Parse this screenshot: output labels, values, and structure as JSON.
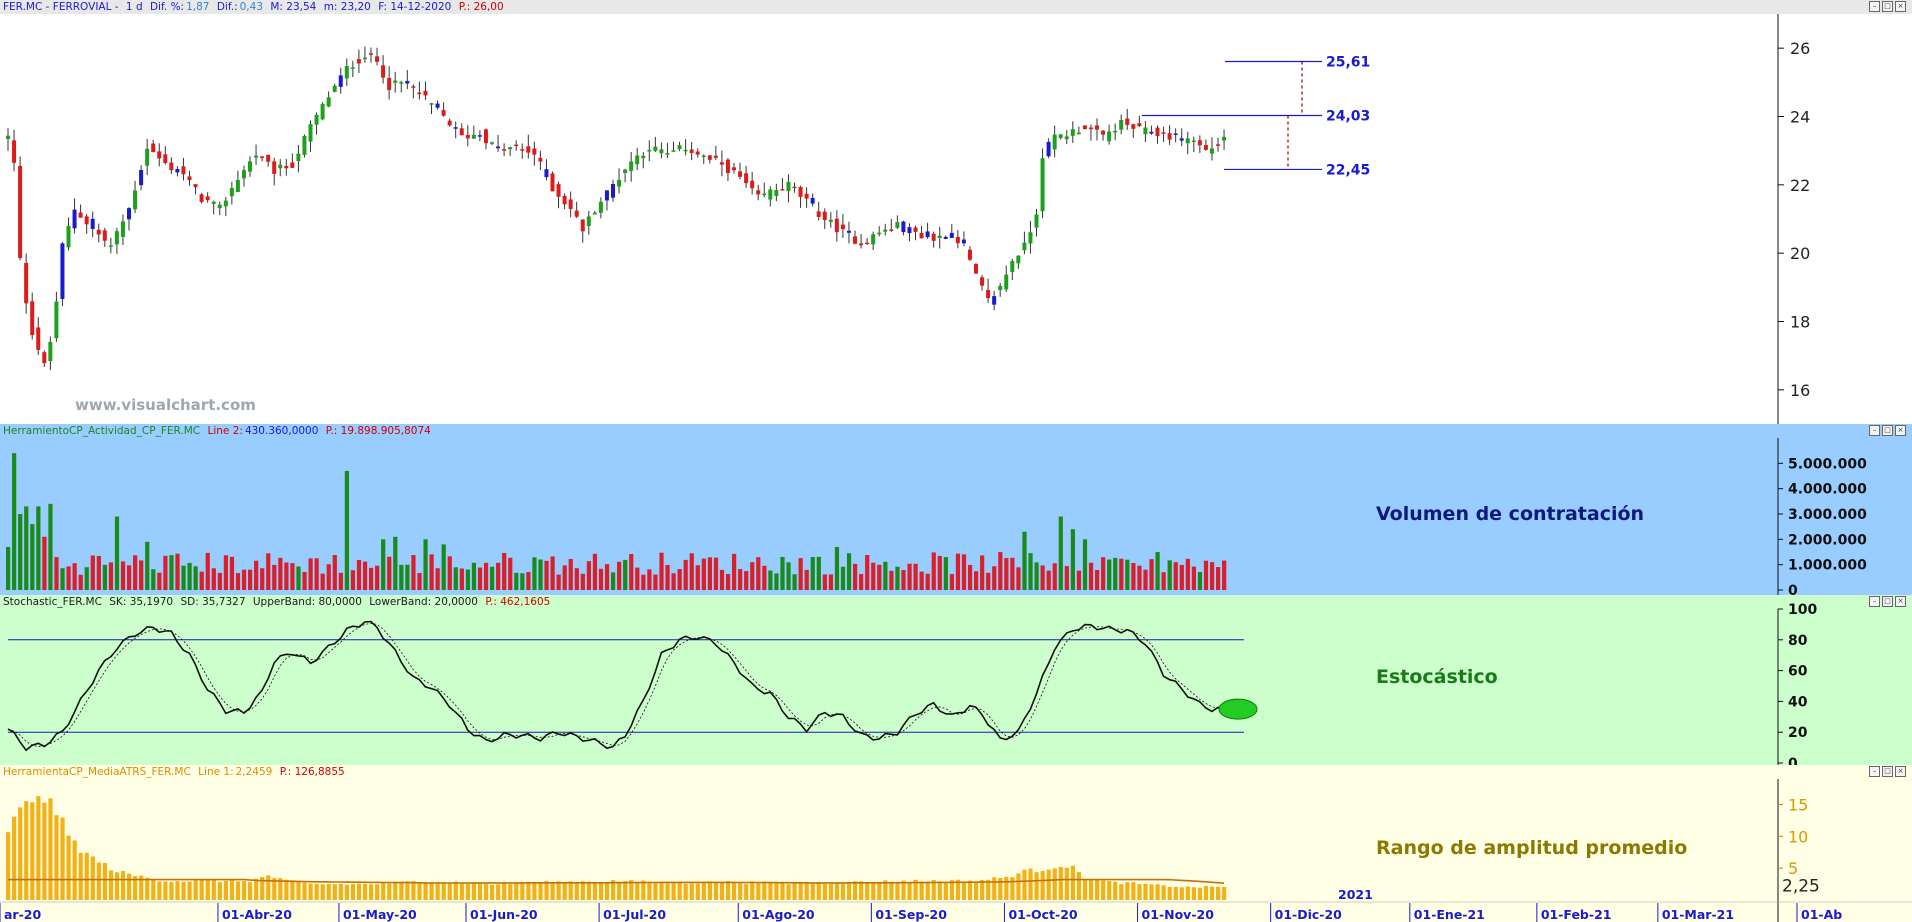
{
  "chart_data": [
    {
      "type": "candlestick",
      "header": {
        "symbol": "FER.MC - FERROVIAL -",
        "period": "1 d",
        "dif_pct_label": "Dif. %:",
        "dif_pct_value": "1,87",
        "dif_label": "Dif.:",
        "dif_value": "0,43",
        "max_label": "M: 23,54",
        "min_label": "m: 23,20",
        "date_label": "F: 14-12-2020",
        "price_label": "P.: 26,00"
      },
      "watermark": "www.visualchart.com",
      "ylim": [
        15.0,
        27.0
      ],
      "yticks": [
        "26",
        "24",
        "22",
        "20",
        "18",
        "16"
      ],
      "ytick_values": [
        26,
        24,
        22,
        20,
        18,
        16
      ],
      "levels": [
        {
          "label": "25,61",
          "value": 25.61
        },
        {
          "label": "24,03",
          "value": 24.03
        },
        {
          "label": "22,45",
          "value": 22.45
        }
      ],
      "price_waypoints": [
        [
          0,
          23.4
        ],
        [
          1,
          22.6
        ],
        [
          2,
          19.8
        ],
        [
          3,
          18.6
        ],
        [
          4,
          17.7
        ],
        [
          5,
          17.2
        ],
        [
          6,
          16.7
        ],
        [
          7,
          17.4
        ],
        [
          8,
          18.6
        ],
        [
          9,
          20.2
        ],
        [
          11,
          21.3
        ],
        [
          14,
          20.7
        ],
        [
          17,
          20.2
        ],
        [
          20,
          21.3
        ],
        [
          23,
          23.1
        ],
        [
          26,
          22.6
        ],
        [
          29,
          22.3
        ],
        [
          32,
          21.6
        ],
        [
          35,
          21.3
        ],
        [
          38,
          22.2
        ],
        [
          41,
          22.9
        ],
        [
          44,
          22.4
        ],
        [
          47,
          22.6
        ],
        [
          50,
          23.7
        ],
        [
          53,
          24.6
        ],
        [
          56,
          25.4
        ],
        [
          59,
          25.8
        ],
        [
          61,
          25.6
        ],
        [
          63,
          24.9
        ],
        [
          66,
          25.0
        ],
        [
          69,
          24.5
        ],
        [
          72,
          24.0
        ],
        [
          75,
          23.4
        ],
        [
          78,
          23.5
        ],
        [
          81,
          23.0
        ],
        [
          84,
          23.1
        ],
        [
          87,
          22.9
        ],
        [
          90,
          21.9
        ],
        [
          93,
          21.3
        ],
        [
          95,
          20.7
        ],
        [
          97,
          21.3
        ],
        [
          100,
          22.0
        ],
        [
          103,
          22.7
        ],
        [
          106,
          23.1
        ],
        [
          109,
          22.9
        ],
        [
          112,
          23.1
        ],
        [
          115,
          22.8
        ],
        [
          118,
          22.6
        ],
        [
          121,
          22.2
        ],
        [
          124,
          21.6
        ],
        [
          126,
          21.8
        ],
        [
          129,
          22.0
        ],
        [
          132,
          21.5
        ],
        [
          135,
          21.0
        ],
        [
          138,
          20.6
        ],
        [
          141,
          20.3
        ],
        [
          144,
          20.6
        ],
        [
          147,
          20.8
        ],
        [
          150,
          20.6
        ],
        [
          153,
          20.4
        ],
        [
          156,
          20.6
        ],
        [
          158,
          20.2
        ],
        [
          160,
          19.3
        ],
        [
          162,
          18.6
        ],
        [
          164,
          19.0
        ],
        [
          166,
          19.8
        ],
        [
          168,
          20.2
        ],
        [
          170,
          21.2
        ],
        [
          171,
          22.9
        ],
        [
          173,
          23.4
        ],
        [
          175,
          23.5
        ],
        [
          178,
          23.7
        ],
        [
          181,
          23.4
        ],
        [
          184,
          23.8
        ],
        [
          187,
          23.6
        ],
        [
          190,
          23.5
        ],
        [
          193,
          23.4
        ],
        [
          196,
          23.3
        ],
        [
          198,
          23.0
        ],
        [
          200,
          23.2
        ],
        [
          201,
          23.4
        ]
      ],
      "x_labels": [
        {
          "label": "ar-20",
          "idx": 0
        },
        {
          "label": "01-Abr-20",
          "idx": 19
        },
        {
          "label": "01-May-20",
          "idx": 39
        },
        {
          "label": "01-Jun-20",
          "idx": 60
        },
        {
          "label": "01-Jul-20",
          "idx": 82
        },
        {
          "label": "01-Ago-20",
          "idx": 105
        },
        {
          "label": "01-Sep-20",
          "idx": 127
        },
        {
          "label": "01-Oct-20",
          "idx": 149
        },
        {
          "label": "01-Nov-20",
          "idx": 171
        },
        {
          "label": "01-Dic-20",
          "idx": 193
        },
        {
          "label": "01-Ene-21",
          "idx": 216
        },
        {
          "label": "01-Feb-21",
          "idx": 237
        },
        {
          "label": "01-Mar-21",
          "idx": 257
        },
        {
          "label": "01-Ab",
          "idx": 280
        }
      ],
      "year_label": "2021",
      "colors": {
        "up": "#1ea01e",
        "down": "#dd1b1b",
        "neutral": "#1a1ad0"
      }
    },
    {
      "type": "bar",
      "header": {
        "name": "HerramientoCP_Actividad_CP_FER.MC",
        "line_label": "Line 2:",
        "line_value": "430.360,0000",
        "p_label": "P.: 19.898.905,8074"
      },
      "title": "Volumen de contratación",
      "ylim": [
        0,
        6000000
      ],
      "yticks": [
        "5.000.000",
        "4.000.000",
        "3.000.000",
        "2.000.000",
        "1.000.000",
        "0"
      ],
      "ytick_values": [
        5000000,
        4000000,
        3000000,
        2000000,
        1000000,
        0
      ],
      "spikes": [
        [
          0,
          1700000
        ],
        [
          1,
          5400000
        ],
        [
          2,
          3000000
        ],
        [
          3,
          3300000
        ],
        [
          4,
          2600000
        ],
        [
          5,
          3300000
        ],
        [
          6,
          2100000
        ],
        [
          7,
          3400000
        ],
        [
          18,
          2900000
        ],
        [
          23,
          1900000
        ],
        [
          56,
          4700000
        ],
        [
          62,
          2000000
        ],
        [
          64,
          2100000
        ],
        [
          69,
          2000000
        ],
        [
          72,
          1800000
        ],
        [
          137,
          1700000
        ],
        [
          168,
          2300000
        ],
        [
          174,
          2900000
        ],
        [
          176,
          2400000
        ],
        [
          178,
          2000000
        ],
        [
          190,
          1500000
        ]
      ],
      "colors": {
        "up": "#1a8a1a",
        "down": "#d9202a"
      }
    },
    {
      "type": "line",
      "header": {
        "name": "Stochastic_FER.MC",
        "sk_label": "SK: 35,1970",
        "sd_label": "SD: 35,7327",
        "upper_label": "UpperBand: 80,0000",
        "lower_label": "LowerBand: 20,0000",
        "p_label": "P.: 462,1605"
      },
      "title": "Estocástico",
      "ylim": [
        0,
        100
      ],
      "yticks": [
        "100",
        "80",
        "60",
        "40",
        "20",
        "0"
      ],
      "ytick_values": [
        100,
        80,
        60,
        40,
        20,
        0
      ],
      "bands": [
        80,
        20
      ],
      "series": [
        {
          "waypoints": [
            [
              0,
              22
            ],
            [
              3,
              10
            ],
            [
              6,
              12
            ],
            [
              9,
              20
            ],
            [
              12,
              40
            ],
            [
              15,
              60
            ],
            [
              18,
              75
            ],
            [
              21,
              84
            ],
            [
              24,
              88
            ],
            [
              27,
              84
            ],
            [
              30,
              70
            ],
            [
              33,
              48
            ],
            [
              36,
              34
            ],
            [
              39,
              33
            ],
            [
              42,
              46
            ],
            [
              44,
              66
            ],
            [
              47,
              72
            ],
            [
              50,
              65
            ],
            [
              53,
              75
            ],
            [
              56,
              86
            ],
            [
              59,
              92
            ],
            [
              61,
              88
            ],
            [
              64,
              72
            ],
            [
              67,
              55
            ],
            [
              70,
              49
            ],
            [
              73,
              38
            ],
            [
              76,
              22
            ],
            [
              79,
              14
            ],
            [
              82,
              18
            ],
            [
              85,
              18
            ],
            [
              88,
              16
            ],
            [
              91,
              20
            ],
            [
              94,
              17
            ],
            [
              97,
              14
            ],
            [
              100,
              10
            ],
            [
              102,
              18
            ],
            [
              105,
              40
            ],
            [
              108,
              70
            ],
            [
              111,
              80
            ],
            [
              114,
              82
            ],
            [
              117,
              78
            ],
            [
              120,
              65
            ],
            [
              123,
              50
            ],
            [
              126,
              45
            ],
            [
              129,
              30
            ],
            [
              132,
              22
            ],
            [
              135,
              33
            ],
            [
              138,
              30
            ],
            [
              141,
              18
            ],
            [
              144,
              16
            ],
            [
              147,
              20
            ],
            [
              150,
              32
            ],
            [
              153,
              38
            ],
            [
              156,
              30
            ],
            [
              159,
              37
            ],
            [
              161,
              32
            ],
            [
              164,
              15
            ],
            [
              167,
              20
            ],
            [
              170,
              45
            ],
            [
              173,
              75
            ],
            [
              176,
              87
            ],
            [
              179,
              89
            ],
            [
              182,
              87
            ],
            [
              185,
              86
            ],
            [
              188,
              78
            ],
            [
              191,
              58
            ],
            [
              194,
              48
            ],
            [
              197,
              38
            ],
            [
              199,
              35
            ],
            [
              201,
              35
            ]
          ]
        }
      ],
      "colors": {
        "line": "#111111",
        "band": "#1a1ab0",
        "marker": "#22cc22"
      }
    },
    {
      "type": "bar",
      "header": {
        "name": "HerramientaCP_MediaATRS_FER.MC",
        "line_label": "Line 1:",
        "line_value": "2,2459",
        "p_label": "P.: 126,8855"
      },
      "title": "Rango de amplitud promedio",
      "ylim": [
        0,
        19
      ],
      "yticks": [
        "15",
        "10",
        "5"
      ],
      "ytick_values": [
        15,
        10,
        5
      ],
      "last_value_label": "2,25",
      "last_value": 2.25,
      "waypoints": [
        [
          0,
          11
        ],
        [
          2,
          14
        ],
        [
          4,
          15.5
        ],
        [
          5,
          17
        ],
        [
          6,
          16
        ],
        [
          8,
          14
        ],
        [
          10,
          10
        ],
        [
          12,
          8
        ],
        [
          14,
          6.5
        ],
        [
          16,
          5.5
        ],
        [
          18,
          4.5
        ],
        [
          20,
          4
        ],
        [
          23,
          3.5
        ],
        [
          26,
          3
        ],
        [
          30,
          3
        ],
        [
          35,
          3
        ],
        [
          40,
          3
        ],
        [
          43,
          3.8
        ],
        [
          46,
          3
        ],
        [
          50,
          2.5
        ],
        [
          60,
          2.5
        ],
        [
          70,
          3
        ],
        [
          80,
          2.5
        ],
        [
          90,
          2.8
        ],
        [
          100,
          3
        ],
        [
          110,
          2.7
        ],
        [
          120,
          2.8
        ],
        [
          130,
          2.6
        ],
        [
          140,
          2.8
        ],
        [
          150,
          3
        ],
        [
          160,
          3
        ],
        [
          165,
          3.6
        ],
        [
          168,
          4.5
        ],
        [
          171,
          4.8
        ],
        [
          174,
          5.5
        ],
        [
          176,
          5.0
        ],
        [
          178,
          3.5
        ],
        [
          182,
          2.8
        ],
        [
          186,
          2.6
        ],
        [
          190,
          2.3
        ],
        [
          195,
          2.0
        ],
        [
          201,
          2.1
        ]
      ],
      "colors": {
        "bar": "#f2b217",
        "line": "#c2700a"
      }
    }
  ]
}
